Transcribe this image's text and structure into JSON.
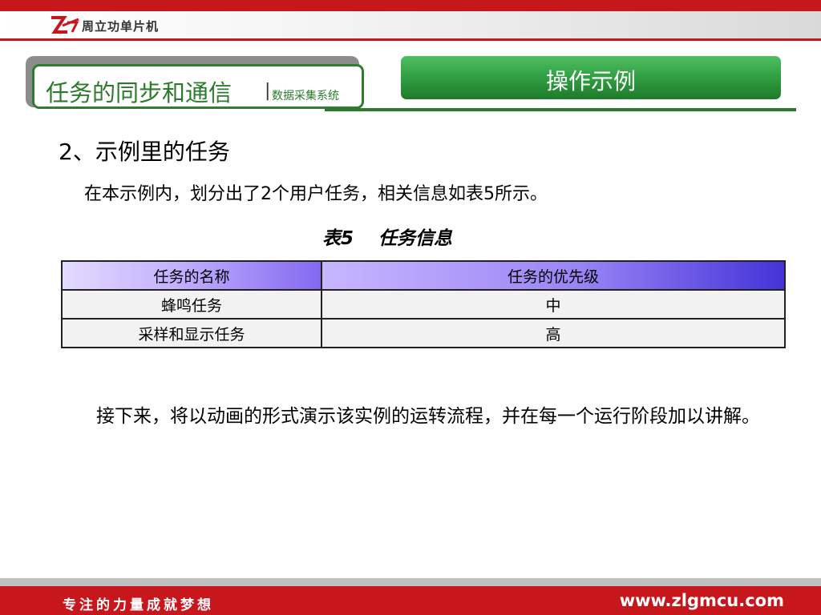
{
  "header": {
    "company": "周立功单片机"
  },
  "title": {
    "main": "任务的同步和通信",
    "separator": "|",
    "sub": "数据采集系统"
  },
  "section": {
    "label": "操作示例"
  },
  "content": {
    "heading": "2、示例里的任务",
    "intro": "在本示例内，划分出了2个用户任务，相关信息如表5所示。",
    "caption": "表5　 任务信息",
    "table": {
      "headers": [
        "任务的名称",
        "任务的优先级"
      ],
      "rows": [
        [
          "蜂鸣任务",
          "中"
        ],
        [
          "采样和显示任务",
          "高"
        ]
      ]
    },
    "outro": "接下来，将以动画的形式演示该实例的运转流程，并在每一个运行阶段加以讲解。"
  },
  "footer": {
    "slogan": "专注的力量成就梦想",
    "website": "www.zlgmcu.com"
  },
  "colors": {
    "brand_red": "#c8161d",
    "green": "#2c7a2c",
    "table_header": "#4433d8"
  }
}
